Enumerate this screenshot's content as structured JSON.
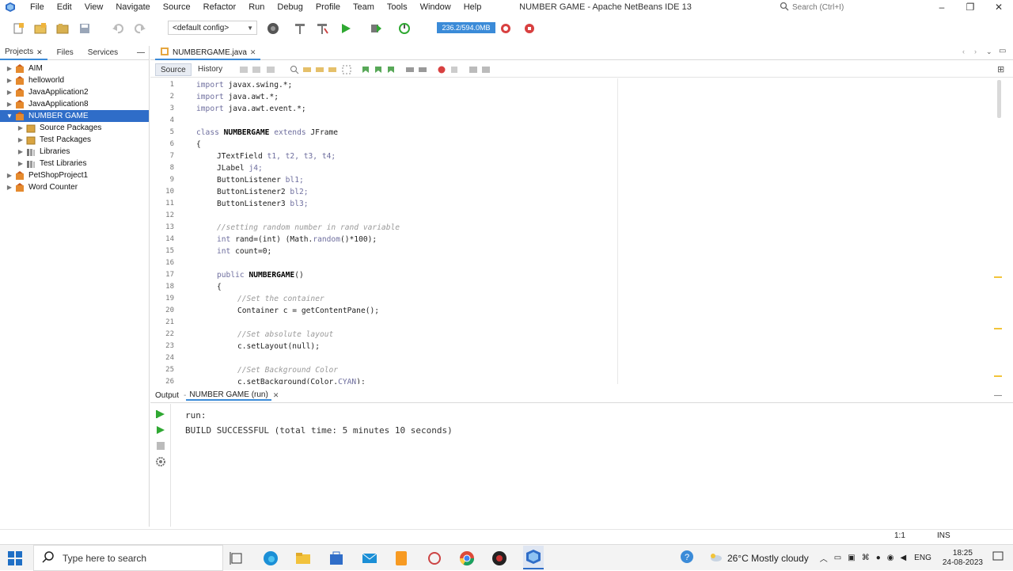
{
  "menubar": {
    "items": [
      "File",
      "Edit",
      "View",
      "Navigate",
      "Source",
      "Refactor",
      "Run",
      "Debug",
      "Profile",
      "Team",
      "Tools",
      "Window",
      "Help"
    ],
    "title": "NUMBER GAME - Apache NetBeans IDE 13",
    "search_placeholder": "Search (Ctrl+I)"
  },
  "toolbar": {
    "config": "<default config>",
    "memory": "236.2/594.0MB"
  },
  "projects": {
    "tabs": [
      "Projects",
      "Files",
      "Services"
    ],
    "tree": [
      {
        "label": "AIM",
        "level": 0,
        "expanded": false,
        "selected": false,
        "icon": "project-icon"
      },
      {
        "label": "helloworld",
        "level": 0,
        "expanded": false,
        "selected": false,
        "icon": "project-icon"
      },
      {
        "label": "JavaApplication2",
        "level": 0,
        "expanded": false,
        "selected": false,
        "icon": "project-icon"
      },
      {
        "label": "JavaApplication8",
        "level": 0,
        "expanded": false,
        "selected": false,
        "icon": "project-icon"
      },
      {
        "label": "NUMBER GAME",
        "level": 0,
        "expanded": true,
        "selected": true,
        "icon": "project-icon"
      },
      {
        "label": "Source Packages",
        "level": 1,
        "expanded": false,
        "selected": false,
        "icon": "package-icon"
      },
      {
        "label": "Test Packages",
        "level": 1,
        "expanded": false,
        "selected": false,
        "icon": "package-icon"
      },
      {
        "label": "Libraries",
        "level": 1,
        "expanded": false,
        "selected": false,
        "icon": "library-icon"
      },
      {
        "label": "Test Libraries",
        "level": 1,
        "expanded": false,
        "selected": false,
        "icon": "library-icon"
      },
      {
        "label": "PetShopProject1",
        "level": 0,
        "expanded": false,
        "selected": false,
        "icon": "project-icon"
      },
      {
        "label": "Word Counter",
        "level": 0,
        "expanded": false,
        "selected": false,
        "icon": "project-icon"
      }
    ]
  },
  "editor": {
    "tab": "NUMBERGAME.java",
    "view_tabs": [
      "Source",
      "History"
    ],
    "lines": [
      {
        "n": "1",
        "indent": 0,
        "parts": [
          [
            "kw",
            "import "
          ],
          [
            "",
            "javax.swing.*;"
          ]
        ]
      },
      {
        "n": "2",
        "indent": 0,
        "parts": [
          [
            "kw",
            "import "
          ],
          [
            "",
            "java.awt.*;"
          ]
        ]
      },
      {
        "n": "3",
        "indent": 0,
        "parts": [
          [
            "kw",
            "import "
          ],
          [
            "",
            "java.awt.event.*;"
          ]
        ]
      },
      {
        "n": "4",
        "indent": 0,
        "parts": []
      },
      {
        "n": "5",
        "indent": 0,
        "parts": [
          [
            "kw",
            "class "
          ],
          [
            "fn",
            "NUMBERGAME"
          ],
          [
            "kw",
            " extends "
          ],
          [
            "",
            "JFrame"
          ]
        ]
      },
      {
        "n": "6",
        "indent": 0,
        "parts": [
          [
            "",
            "{"
          ]
        ]
      },
      {
        "n": "7",
        "indent": 1,
        "parts": [
          [
            "",
            "JTextField "
          ],
          [
            "kw",
            "t1, t2, t3, t4;"
          ]
        ]
      },
      {
        "n": "8",
        "indent": 1,
        "parts": [
          [
            "",
            "JLabel "
          ],
          [
            "kw",
            "j4;"
          ]
        ]
      },
      {
        "n": "9",
        "indent": 1,
        "parts": [
          [
            "",
            "ButtonListener "
          ],
          [
            "kw",
            "bl1;"
          ]
        ]
      },
      {
        "n": "10",
        "indent": 1,
        "parts": [
          [
            "",
            "ButtonListener2 "
          ],
          [
            "kw",
            "bl2;"
          ]
        ]
      },
      {
        "n": "11",
        "indent": 1,
        "parts": [
          [
            "",
            "ButtonListener3 "
          ],
          [
            "kw",
            "bl3;"
          ]
        ]
      },
      {
        "n": "12",
        "indent": 0,
        "parts": []
      },
      {
        "n": "13",
        "indent": 1,
        "parts": [
          [
            "cm",
            "//setting random number in rand variable"
          ]
        ]
      },
      {
        "n": "14",
        "indent": 1,
        "parts": [
          [
            "kw",
            "int "
          ],
          [
            "",
            "rand=(int) (Math."
          ],
          [
            "kw",
            "random"
          ],
          [
            "",
            "()*100);"
          ]
        ]
      },
      {
        "n": "15",
        "indent": 1,
        "parts": [
          [
            "kw",
            "int "
          ],
          [
            "",
            "count=0;"
          ]
        ]
      },
      {
        "n": "16",
        "indent": 0,
        "parts": []
      },
      {
        "n": "17",
        "indent": 1,
        "parts": [
          [
            "kw",
            "public "
          ],
          [
            "fn",
            "NUMBERGAME"
          ],
          [
            "",
            "()"
          ]
        ]
      },
      {
        "n": "18",
        "indent": 1,
        "parts": [
          [
            "",
            "{"
          ]
        ]
      },
      {
        "n": "19",
        "indent": 2,
        "parts": [
          [
            "cm",
            "//Set the container"
          ]
        ]
      },
      {
        "n": "20",
        "indent": 2,
        "parts": [
          [
            "",
            "Container c = getContentPane();"
          ]
        ]
      },
      {
        "n": "21",
        "indent": 0,
        "parts": []
      },
      {
        "n": "22",
        "indent": 2,
        "parts": [
          [
            "cm",
            "//Set absolute layout"
          ]
        ]
      },
      {
        "n": "23",
        "indent": 2,
        "parts": [
          [
            "",
            "c.setLayout(null);"
          ]
        ]
      },
      {
        "n": "24",
        "indent": 0,
        "parts": []
      },
      {
        "n": "25",
        "indent": 2,
        "parts": [
          [
            "cm",
            "//Set Background Color"
          ]
        ]
      },
      {
        "n": "26",
        "indent": 2,
        "parts": [
          [
            "",
            "c.setBackground(Color."
          ],
          [
            "kw",
            "CYAN"
          ],
          [
            "",
            ");"
          ]
        ]
      }
    ]
  },
  "output": {
    "tab_label": "Output",
    "run_tab": "NUMBER GAME (run)",
    "lines": [
      "run:",
      "BUILD SUCCESSFUL (total time: 5 minutes 10 seconds)"
    ]
  },
  "status": {
    "position": "1:1",
    "mode": "INS"
  },
  "taskbar": {
    "search_placeholder": "Type here to search",
    "weather": "26°C  Mostly cloudy",
    "language": "ENG",
    "time": "18:25",
    "date": "24-08-2023"
  }
}
